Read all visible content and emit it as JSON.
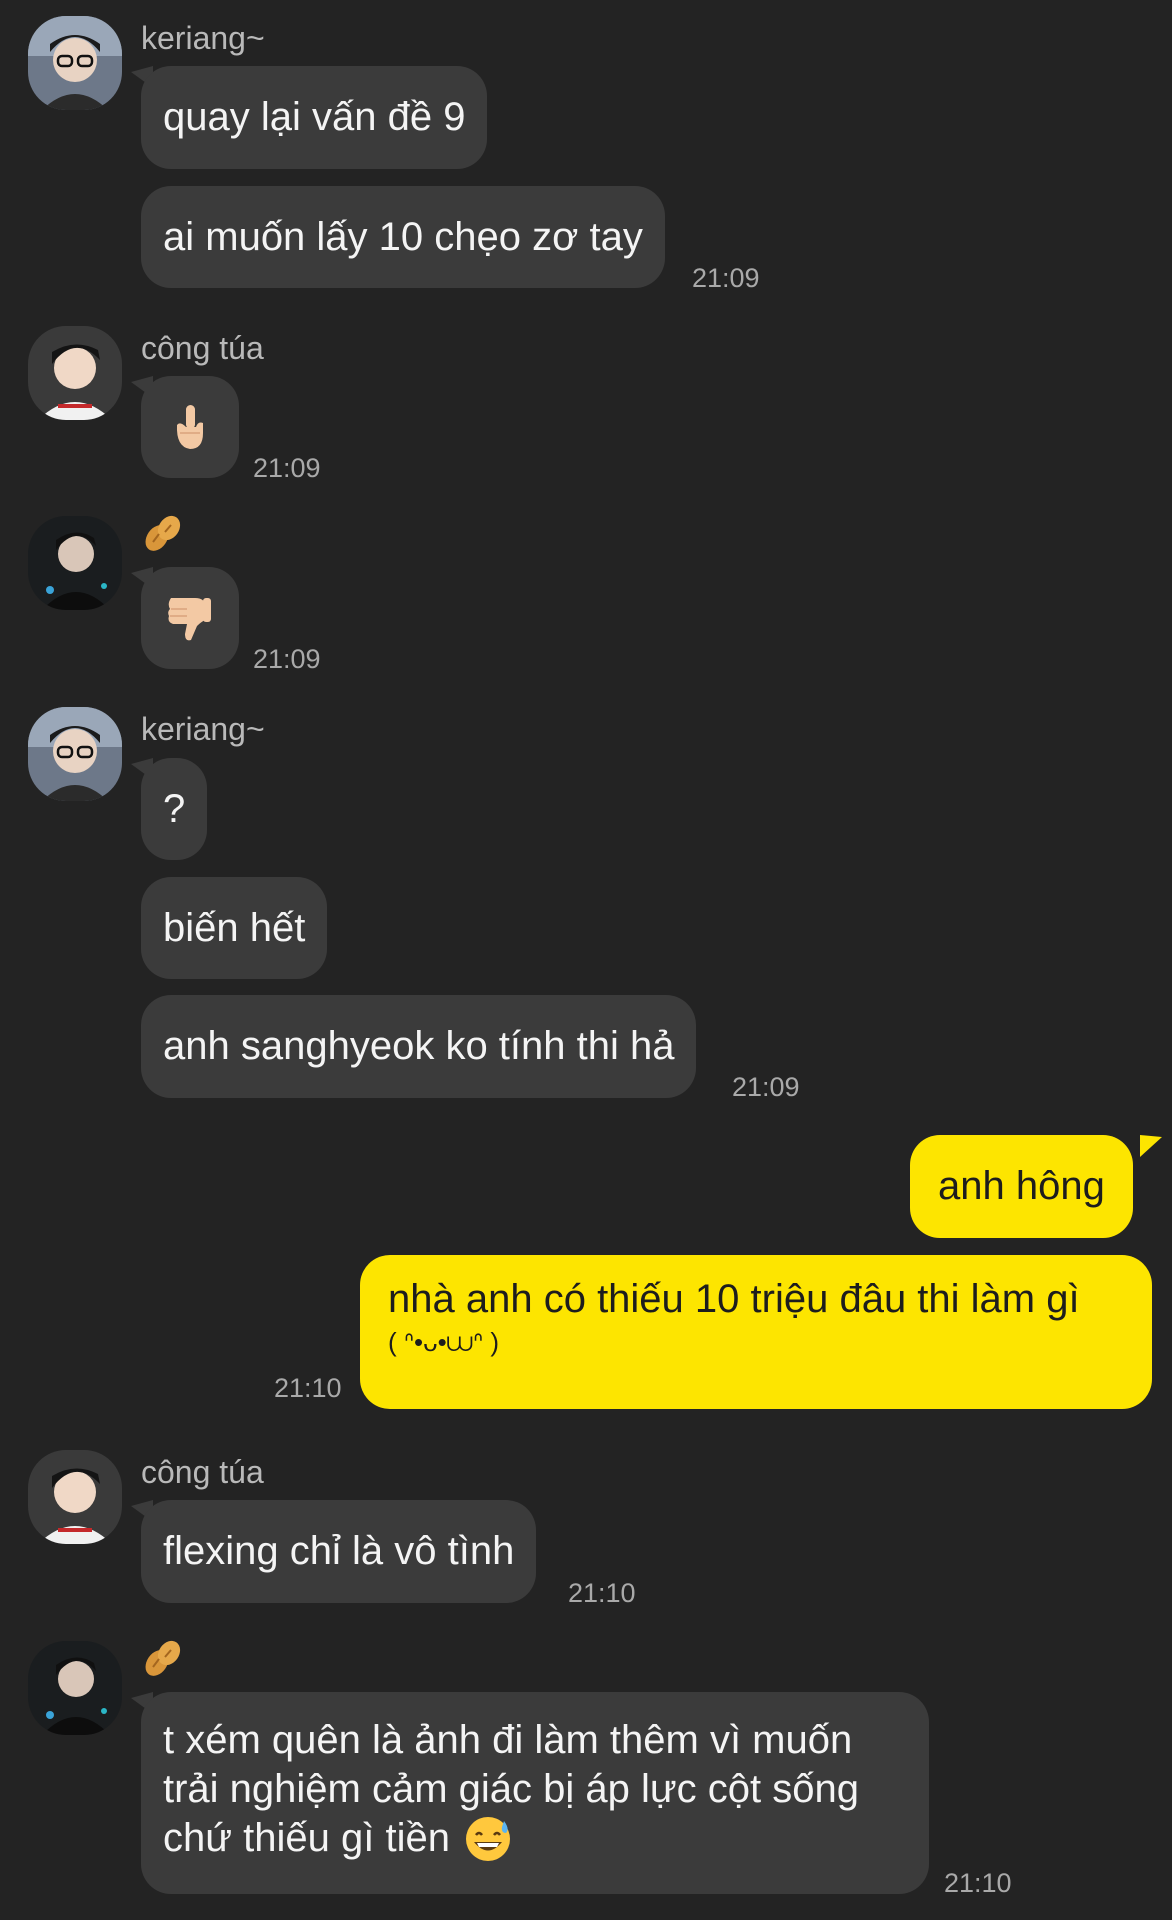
{
  "colors": {
    "background": "#232323",
    "incoming_bubble": "#3b3b3b",
    "outgoing_bubble": "#fde500",
    "timestamp": "#a9a9a9",
    "sender_name": "#b9b9b9"
  },
  "messages": {
    "g1": {
      "sender": "keriang~",
      "b1": "quay lại vấn đề 9",
      "b2": "ai muốn lấy 10 chẹo zơ tay",
      "time": "21:09"
    },
    "g2": {
      "sender": "công túa",
      "emoji": "middle-finger-emoji",
      "time": "21:09"
    },
    "g3": {
      "sender_icon": "peanut-icon",
      "emoji": "thumbs-down-emoji",
      "time": "21:09"
    },
    "g4": {
      "sender": "keriang~",
      "b1": "?",
      "b2": "biến hết",
      "b3": "anh sanghyeok ko tính thi hả",
      "time": "21:09"
    },
    "g5": {
      "b1": "anh hông",
      "b2_line1": "nhà anh có thiếu 10 triệu đâu thi làm gì",
      "b2_line2": "( ᐢ•ᴗ•⩊ᐢ )",
      "time": "21:10"
    },
    "g6": {
      "sender": "công túa",
      "b1": "flexing chỉ là vô tình",
      "time": "21:10"
    },
    "g7": {
      "sender_icon": "peanut-icon",
      "line1": "t xém quên là ảnh đi làm thêm vì muốn",
      "line2": "trải nghiệm cảm giác bị áp lực cột sống",
      "line3": "chứ thiếu gì tiền",
      "emoji": "grinning-sweat-emoji",
      "time": "21:10"
    }
  }
}
